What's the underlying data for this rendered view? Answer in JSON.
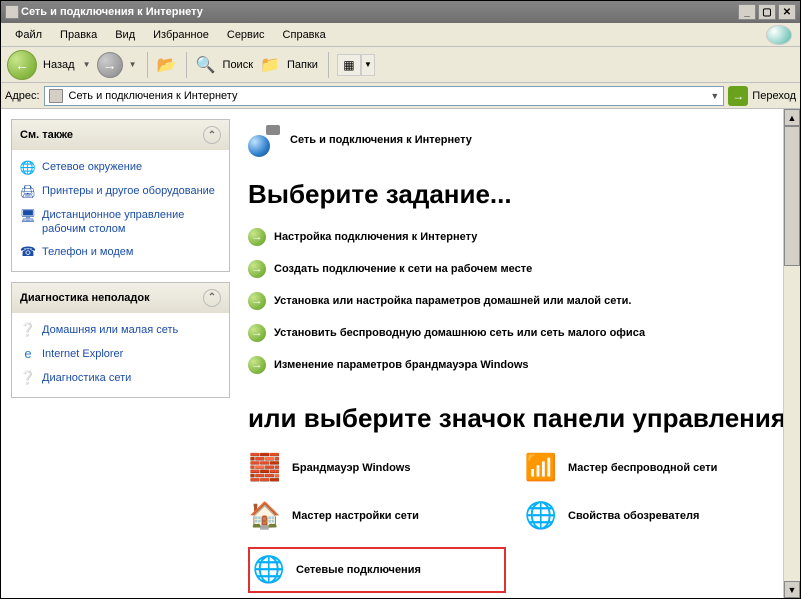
{
  "window": {
    "title": "Сеть и подключения к Интернету"
  },
  "menu": {
    "file": "Файл",
    "edit": "Правка",
    "view": "Вид",
    "favorites": "Избранное",
    "tools": "Сервис",
    "help": "Справка"
  },
  "toolbar": {
    "back": "Назад",
    "search": "Поиск",
    "folders": "Папки"
  },
  "addr": {
    "label": "Адрес:",
    "value": "Сеть и подключения к Интернету",
    "go": "Переход"
  },
  "sidebar": {
    "see_also": {
      "title": "См. также",
      "items": [
        {
          "label": "Сетевое окружение"
        },
        {
          "label": "Принтеры и другое оборудование"
        },
        {
          "label": "Дистанционное управление рабочим столом"
        },
        {
          "label": "Телефон и модем"
        }
      ]
    },
    "diag": {
      "title": "Диагностика неполадок",
      "items": [
        {
          "label": "Домашняя или малая сеть"
        },
        {
          "label": "Internet Explorer"
        },
        {
          "label": "Диагностика сети"
        }
      ]
    }
  },
  "main": {
    "breadcrumb": "Сеть и подключения к Интернету",
    "heading1": "Выберите задание...",
    "tasks": [
      "Настройка подключения к Интернету",
      "Создать подключение к сети на рабочем месте",
      "Установка или настройка параметров домашней или малой сети.",
      "Установить беспроводную домашнюю сеть или сеть малого офиса",
      "Изменение параметров брандмауэра Windows"
    ],
    "heading2": "или выберите значок панели управления",
    "cp_items": [
      {
        "label": "Брандмауэр Windows"
      },
      {
        "label": "Мастер беспроводной сети"
      },
      {
        "label": "Мастер настройки сети"
      },
      {
        "label": "Свойства обозревателя"
      },
      {
        "label": "Сетевые подключения"
      }
    ]
  }
}
